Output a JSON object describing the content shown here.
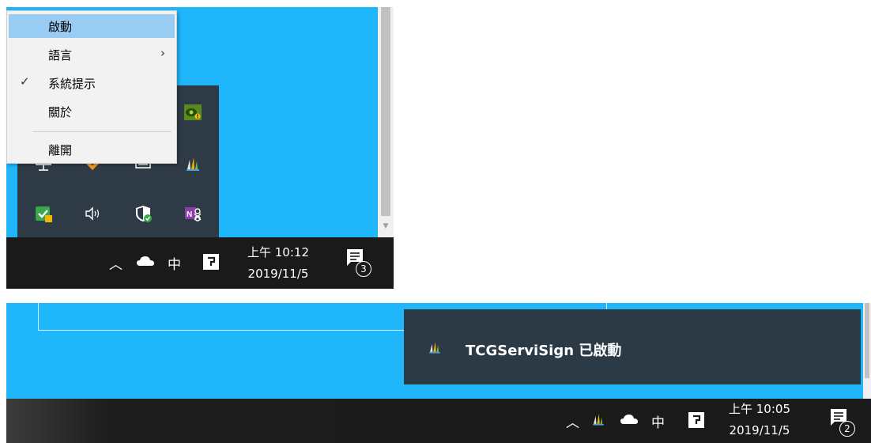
{
  "context_menu": {
    "items": [
      {
        "label": "啟動",
        "highlighted": true
      },
      {
        "label": "語言",
        "has_submenu": true,
        "chevron": "›"
      },
      {
        "label": "系統提示",
        "checked": true,
        "check": "✓"
      },
      {
        "label": "關於"
      },
      {
        "label": "離開"
      }
    ]
  },
  "taskbar_top": {
    "chevron": "︿",
    "ime": "中",
    "time": "上午 10:12",
    "date": "2019/11/5",
    "notification_count": "3"
  },
  "toast": {
    "message": "TCGServiSign 已啟動",
    "icon": "servisign-icon"
  },
  "taskbar_bottom": {
    "chevron": "︿",
    "ime": "中",
    "time": "上午 10:05",
    "date": "2019/11/5",
    "notification_count": "2"
  },
  "colors": {
    "desktop": "#1fb6fa",
    "taskbar": "#1a1a1a",
    "flyout": "#2e3b46",
    "menu_highlight": "#99ccf2"
  }
}
